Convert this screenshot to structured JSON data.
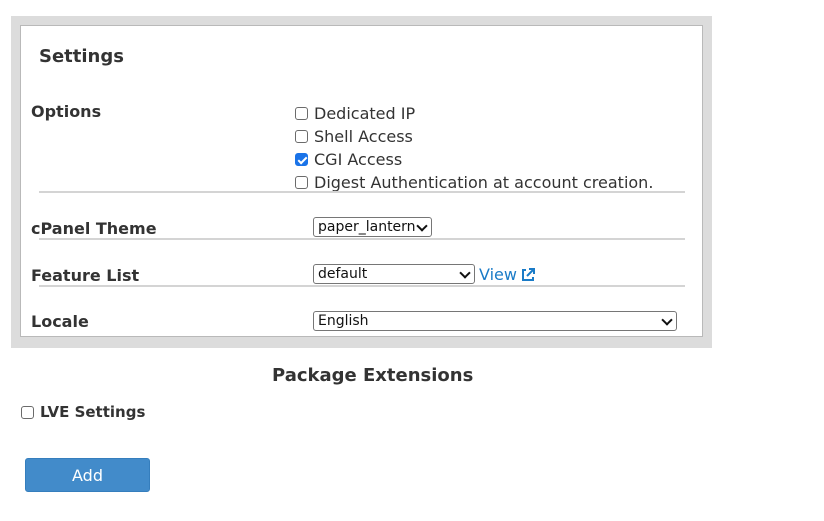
{
  "settings": {
    "title": "Settings",
    "options": {
      "label": "Options",
      "items": [
        {
          "label": "Dedicated IP",
          "checked": false
        },
        {
          "label": "Shell Access",
          "checked": false
        },
        {
          "label": "CGI Access",
          "checked": true
        },
        {
          "label": "Digest Authentication at account creation.",
          "checked": false
        }
      ]
    },
    "cpanel_theme": {
      "label": "cPanel Theme",
      "value": "paper_lantern"
    },
    "feature_list": {
      "label": "Feature List",
      "value": "default",
      "view_label": "View",
      "view_icon": "external-link-icon"
    },
    "locale": {
      "label": "Locale",
      "value": "English"
    }
  },
  "package_extensions": {
    "title": "Package Extensions",
    "lve_settings": {
      "label": "LVE Settings",
      "checked": false
    }
  },
  "add_button": {
    "label": "Add"
  },
  "colors": {
    "accent": "#1a73e8",
    "link": "#1a7bc7",
    "button": "#428bca"
  }
}
